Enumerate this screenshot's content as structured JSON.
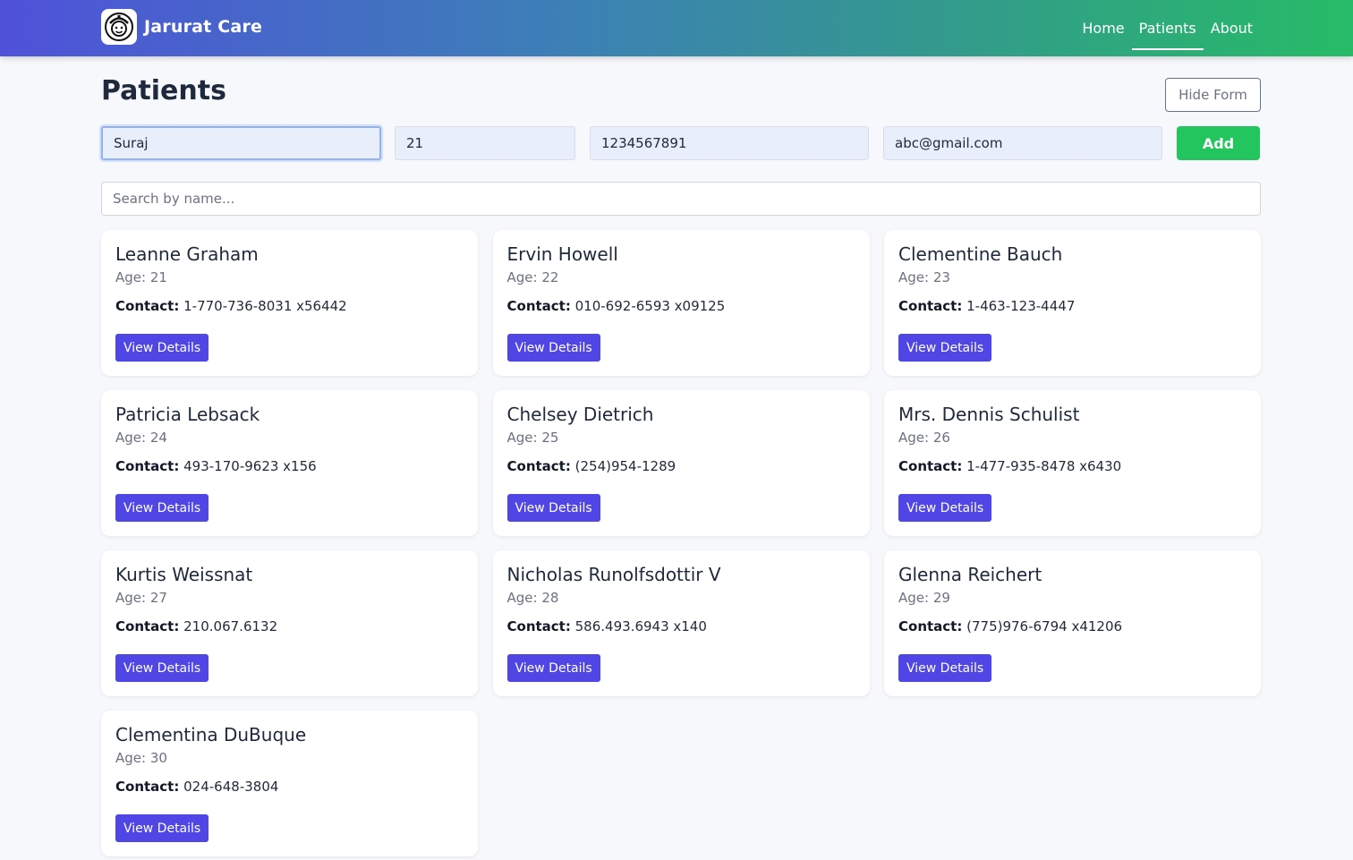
{
  "header": {
    "brand_name": "Jarurat Care",
    "logo_icon": "doctor-face-icon",
    "nav": [
      {
        "label": "Home",
        "active": false
      },
      {
        "label": "Patients",
        "active": true
      },
      {
        "label": "About",
        "active": false
      }
    ],
    "gradient_colors": [
      "#4f52d9",
      "#27bb67"
    ]
  },
  "main": {
    "title": "Patients",
    "hide_form_label": "Hide Form",
    "form": {
      "name_value": "Suraj",
      "age_value": "21",
      "contact_value": "1234567891",
      "email_value": "abc@gmail.com",
      "add_label": "Add"
    },
    "search": {
      "placeholder": "Search by name...",
      "value": ""
    },
    "contact_label": "Contact:",
    "view_details_label": "View Details",
    "patients": [
      {
        "name": "Leanne Graham",
        "age": "Age: 21",
        "contact": "1-770-736-8031 x56442"
      },
      {
        "name": "Ervin Howell",
        "age": "Age: 22",
        "contact": "010-692-6593 x09125"
      },
      {
        "name": "Clementine Bauch",
        "age": "Age: 23",
        "contact": "1-463-123-4447"
      },
      {
        "name": "Patricia Lebsack",
        "age": "Age: 24",
        "contact": "493-170-9623 x156"
      },
      {
        "name": "Chelsey Dietrich",
        "age": "Age: 25",
        "contact": "(254)954-1289"
      },
      {
        "name": "Mrs. Dennis Schulist",
        "age": "Age: 26",
        "contact": "1-477-935-8478 x6430"
      },
      {
        "name": "Kurtis Weissnat",
        "age": "Age: 27",
        "contact": "210.067.6132"
      },
      {
        "name": "Nicholas Runolfsdottir V",
        "age": "Age: 28",
        "contact": "586.493.6943 x140"
      },
      {
        "name": "Glenna Reichert",
        "age": "Age: 29",
        "contact": "(775)976-6794 x41206"
      },
      {
        "name": "Clementina DuBuque",
        "age": "Age: 30",
        "contact": "024-648-3804"
      }
    ]
  },
  "colors": {
    "accent": "#4f46e5",
    "add_button": "#22c55e",
    "background": "#f7f8fc"
  }
}
